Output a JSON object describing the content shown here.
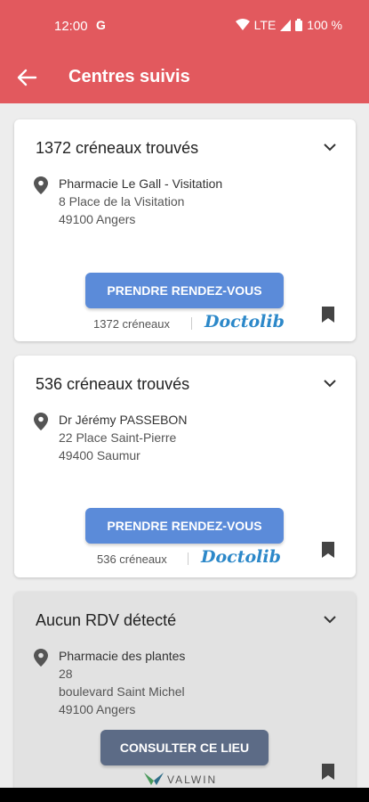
{
  "status_bar": {
    "time": "12:00",
    "network": "LTE",
    "battery": "100 %"
  },
  "app_bar": {
    "title": "Centres suivis"
  },
  "cards": [
    {
      "title": "1372 créneaux trouvés",
      "place": "Pharmacie Le Gall - Visitation",
      "address_lines": [
        "8 Place de la Visitation",
        "49100 Angers"
      ],
      "button_label": "PRENDRE RENDEZ-VOUS",
      "slots_text": "1372 créneaux",
      "platform": "Doctolib"
    },
    {
      "title": "536 créneaux trouvés",
      "place": "Dr Jérémy PASSEBON",
      "address_lines": [
        "22 Place Saint-Pierre",
        "49400 Saumur"
      ],
      "button_label": "PRENDRE RENDEZ-VOUS",
      "slots_text": "536 créneaux",
      "platform": "Doctolib"
    },
    {
      "title": "Aucun RDV détecté",
      "place": "Pharmacie des plantes",
      "address_lines": [
        "28",
        "boulevard Saint Michel",
        "49100 Angers"
      ],
      "button_label": "CONSULTER CE LIEU",
      "platform": "VALWIN"
    }
  ],
  "colors": {
    "primary": "#e2595e",
    "button": "#5b8bd9",
    "consult_button": "#5c6b86",
    "doctolib": "#2c88c9"
  }
}
